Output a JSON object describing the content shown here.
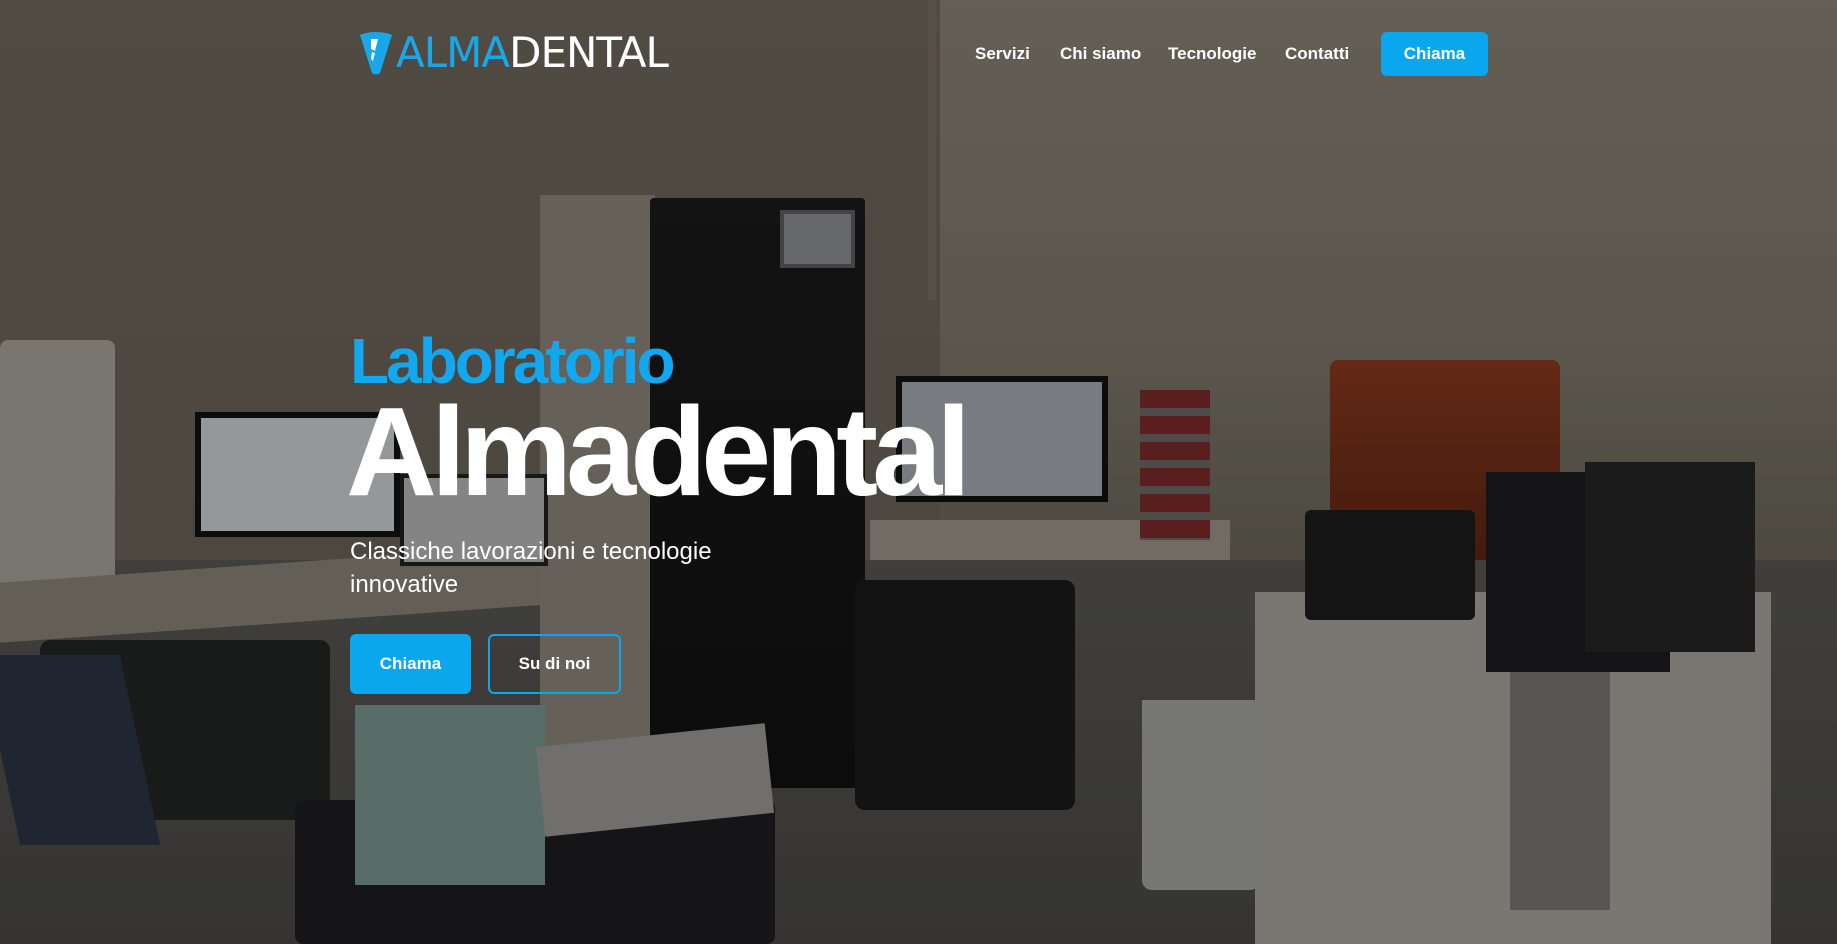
{
  "brand": {
    "logo_part1": "ALMA",
    "logo_part2": "DENTAL",
    "logo_icon": "tooth-icon",
    "accent_color": "#0aa6ee"
  },
  "nav": {
    "items": [
      {
        "label": "Servizi"
      },
      {
        "label": "Chi siamo"
      },
      {
        "label": "Tecnologie"
      },
      {
        "label": "Contatti"
      }
    ],
    "cta_label": "Chiama"
  },
  "hero": {
    "kicker": "Laboratorio",
    "title": "Almadental",
    "subtitle": "Classiche lavorazioni e tecnologie innovative",
    "primary_button": "Chiama",
    "secondary_button": "Su di noi"
  }
}
